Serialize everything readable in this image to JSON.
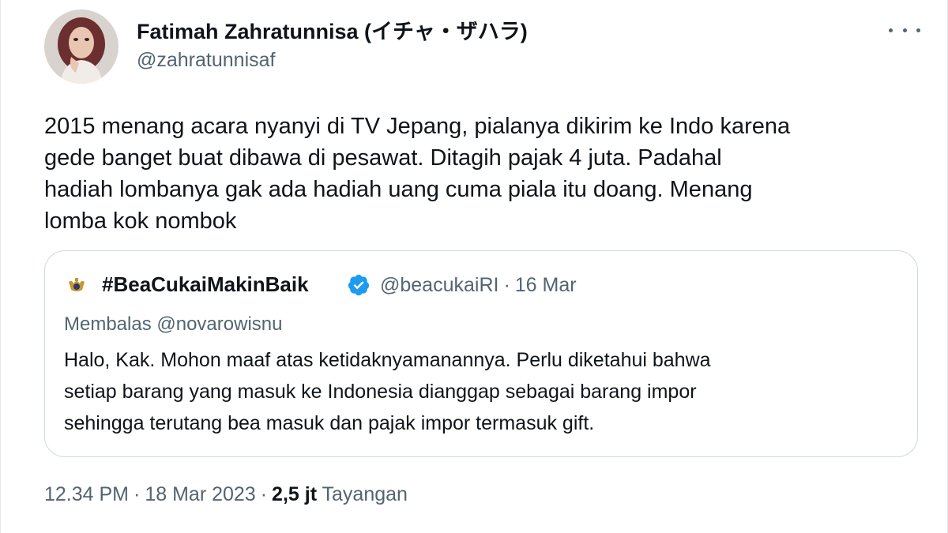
{
  "tweet": {
    "author": {
      "name": "Fatimah Zahratunnisa (イチャ・ザハラ)",
      "handle": "@zahratunnisaf"
    },
    "more_icon": "more-horizontal-icon",
    "text": "2015 menang acara nyanyi di TV Jepang, pialanya dikirim ke Indo karena\ngede banget buat dibawa di pesawat. Ditagih pajak 4 juta. Padahal\nhadiah lombanya gak ada hadiah uang cuma piala itu doang. Menang\nlomba kok nombok",
    "quoted": {
      "name": "#BeaCukaiMakinBaik",
      "verified_icon": "verified-badge-icon",
      "handle": "@beacukaiRI",
      "separator": "·",
      "date": "16 Mar",
      "reply_to": "Membalas @novarowisnu",
      "text": "Halo, Kak. Mohon maaf atas ketidaknyamanannya. Perlu diketahui bahwa\nsetiap barang yang masuk ke Indonesia dianggap sebagai barang impor\nsehingga terutang bea masuk dan pajak impor termasuk gift."
    },
    "footer": {
      "time": "12.34 PM",
      "separator": "·",
      "date": "18 Mar 2023",
      "views_count": "2,5 jt",
      "views_label": "Tayangan"
    }
  },
  "colors": {
    "text_primary": "#0f1419",
    "text_secondary": "#536471",
    "border": "#cfd9de",
    "verified_blue": "#1d9bf0"
  }
}
